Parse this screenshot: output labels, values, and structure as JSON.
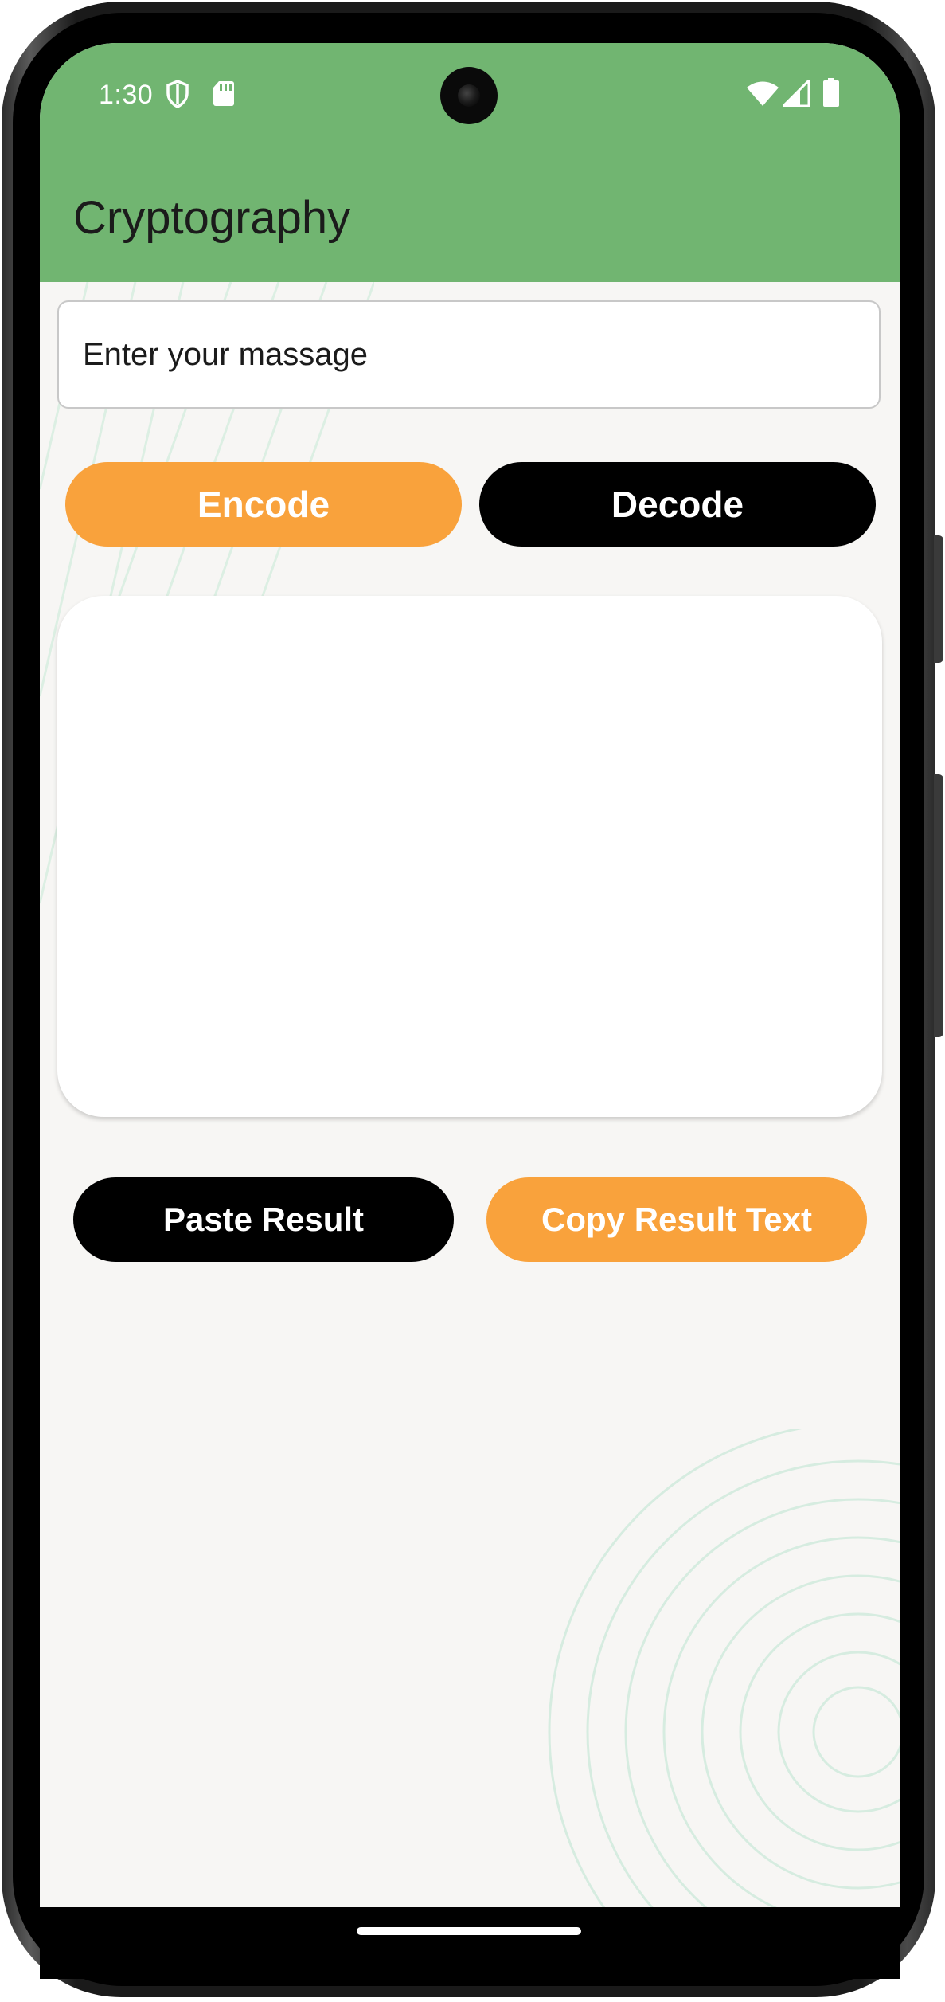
{
  "status_bar": {
    "time": "1:30",
    "icons": [
      "shield-icon",
      "sd-card-icon",
      "wifi-icon",
      "signal-icon",
      "battery-icon"
    ]
  },
  "app_bar": {
    "title": "Cryptography",
    "color": "#71b571"
  },
  "message_input": {
    "placeholder": "Enter your massage"
  },
  "actions": {
    "encode_label": "Encode",
    "decode_label": "Decode",
    "paste_label": "Paste Result",
    "copy_label": "Copy Result Text"
  },
  "result": {
    "text": ""
  },
  "colors": {
    "accent": "#f9a23c",
    "dark": "#000000",
    "background": "#f7f6f4"
  }
}
